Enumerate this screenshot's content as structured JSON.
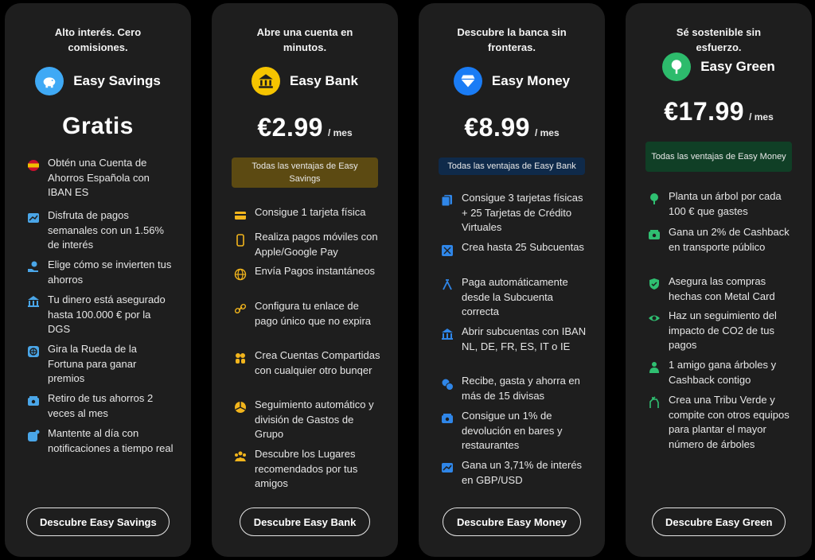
{
  "colors": {
    "savings_logo": "#3fa9f5",
    "bank_logo": "#f5c400",
    "money_logo": "#1a7cf5",
    "green_logo": "#2dbb6c",
    "savings_icon": "#4aa6e8",
    "bank_icon": "#f2b51c",
    "money_icon": "#2f86e8",
    "green_icon": "#2fbf71",
    "badge_bank": "#5c4a12",
    "badge_money": "#0f2a4a",
    "badge_green": "#103f26"
  },
  "plans": [
    {
      "tagline": "Alto interés. Cero comisiones.",
      "name": "Easy Savings",
      "logo_icon": "piggy-bank-icon",
      "price": "Gratis",
      "unit": "",
      "badge": "",
      "cta": "Descubre Easy Savings",
      "features": [
        {
          "icon": "spain-flag-icon",
          "text": "Obtén una Cuenta de Ahorros Española con IBAN ES"
        },
        {
          "icon": "chart-icon",
          "text": "Disfruta de pagos semanales con un 1.56% de interés"
        },
        {
          "icon": "hand-invest-icon",
          "text": "Elige cómo se invierten tus ahorros"
        },
        {
          "icon": "bank-building-icon",
          "text": "Tu dinero está asegurado hasta 100.000 € por la DGS"
        },
        {
          "icon": "wheel-icon",
          "text": "Gira la Rueda de la Fortuna para ganar premios"
        },
        {
          "icon": "wallet-icon",
          "text": "Retiro de tus ahorros 2 veces al mes"
        },
        {
          "icon": "notification-icon",
          "text": "Mantente al día con notificaciones a tiempo real"
        }
      ]
    },
    {
      "tagline": "Abre una cuenta en minutos.",
      "name": "Easy Bank",
      "logo_icon": "bank-icon",
      "price": "€2.99",
      "unit": "/ mes",
      "badge": "Todas las ventajas de Easy Savings",
      "cta": "Descubre Easy Bank",
      "features": [
        {
          "icon": "card-icon",
          "text": "Consigue 1 tarjeta física"
        },
        {
          "icon": "phone-icon",
          "text": "Realiza pagos móviles con Apple/Google Pay"
        },
        {
          "icon": "globe-icon",
          "text": "Envía Pagos instantáneos"
        },
        {
          "icon": "link-icon",
          "text": "Configura tu enlace de pago único que no expira"
        },
        {
          "icon": "people-icon",
          "text": "Crea Cuentas Compartidas con cualquier otro bunqer"
        },
        {
          "icon": "pie-chart-icon",
          "text": "Seguimiento automático y división de Gastos de Grupo"
        },
        {
          "icon": "group-icon",
          "text": "Descubre los Lugares recomendados por tus amigos"
        }
      ]
    },
    {
      "tagline": "Descubre la banca sin fronteras.",
      "name": "Easy Money",
      "logo_icon": "diamond-icon",
      "price": "€8.99",
      "unit": "/ mes",
      "badge": "Todas las ventajas de Easy Bank",
      "cta": "Descubre Easy Money",
      "features": [
        {
          "icon": "cards-icon",
          "text": "Consigue 3 tarjetas físicas + 25 Tarjetas de Crédito Virtuales"
        },
        {
          "icon": "subaccount-icon",
          "text": "Crea hasta 25 Subcuentas"
        },
        {
          "icon": "auto-pay-icon",
          "text": "Paga automáticamente desde la Subcuenta correcta"
        },
        {
          "icon": "bank-building-icon",
          "text": "Abrir subcuentas con IBAN NL, DE, FR, ES, IT o IE"
        },
        {
          "icon": "currency-icon",
          "text": "Recibe, gasta y ahorra en más de 15 divisas"
        },
        {
          "icon": "cashback-icon",
          "text": "Consigue un 1% de devolución en bares y restaurantes"
        },
        {
          "icon": "chart-icon",
          "text": "Gana un 3,71% de interés en GBP/USD"
        }
      ]
    },
    {
      "tagline": "Sé sostenible sin esfuerzo.",
      "name": "Easy Green",
      "logo_icon": "tree-icon",
      "price": "€17.99",
      "unit": "/ mes",
      "badge": "Todas las ventajas de Easy Money",
      "cta": "Descubre Easy Green",
      "features": [
        {
          "icon": "tree-icon",
          "text": "Planta un árbol por cada 100 € que gastes"
        },
        {
          "icon": "cashback-icon",
          "text": "Gana un 2% de Cashback en transporte público"
        },
        {
          "icon": "shield-icon",
          "text": "Asegura las compras hechas con Metal Card"
        },
        {
          "icon": "eye-icon",
          "text": "Haz un seguimiento del impacto de CO2 de tus pagos"
        },
        {
          "icon": "friends-icon",
          "text": "1 amigo gana árboles y Cashback contigo"
        },
        {
          "icon": "tribe-icon",
          "text": "Crea una Tribu Verde y compite con otros equipos para plantar el mayor número de árboles"
        }
      ]
    }
  ]
}
